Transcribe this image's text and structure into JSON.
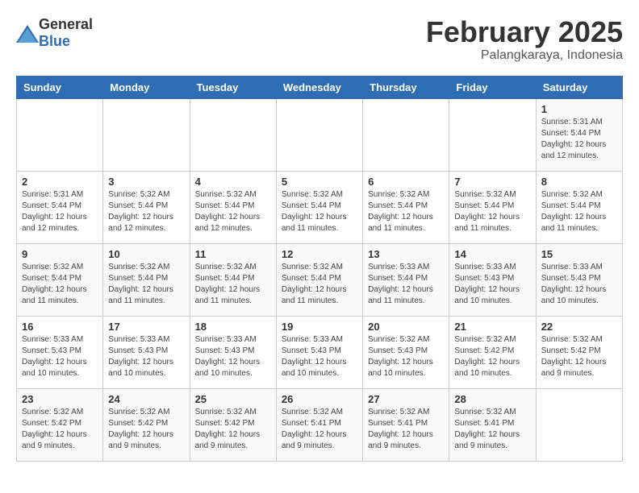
{
  "app": {
    "name_general": "General",
    "name_blue": "Blue"
  },
  "header": {
    "month": "February 2025",
    "location": "Palangkaraya, Indonesia"
  },
  "weekdays": [
    "Sunday",
    "Monday",
    "Tuesday",
    "Wednesday",
    "Thursday",
    "Friday",
    "Saturday"
  ],
  "weeks": [
    [
      {
        "day": "",
        "info": ""
      },
      {
        "day": "",
        "info": ""
      },
      {
        "day": "",
        "info": ""
      },
      {
        "day": "",
        "info": ""
      },
      {
        "day": "",
        "info": ""
      },
      {
        "day": "",
        "info": ""
      },
      {
        "day": "1",
        "info": "Sunrise: 5:31 AM\nSunset: 5:44 PM\nDaylight: 12 hours\nand 12 minutes."
      }
    ],
    [
      {
        "day": "2",
        "info": "Sunrise: 5:31 AM\nSunset: 5:44 PM\nDaylight: 12 hours\nand 12 minutes."
      },
      {
        "day": "3",
        "info": "Sunrise: 5:32 AM\nSunset: 5:44 PM\nDaylight: 12 hours\nand 12 minutes."
      },
      {
        "day": "4",
        "info": "Sunrise: 5:32 AM\nSunset: 5:44 PM\nDaylight: 12 hours\nand 12 minutes."
      },
      {
        "day": "5",
        "info": "Sunrise: 5:32 AM\nSunset: 5:44 PM\nDaylight: 12 hours\nand 11 minutes."
      },
      {
        "day": "6",
        "info": "Sunrise: 5:32 AM\nSunset: 5:44 PM\nDaylight: 12 hours\nand 11 minutes."
      },
      {
        "day": "7",
        "info": "Sunrise: 5:32 AM\nSunset: 5:44 PM\nDaylight: 12 hours\nand 11 minutes."
      },
      {
        "day": "8",
        "info": "Sunrise: 5:32 AM\nSunset: 5:44 PM\nDaylight: 12 hours\nand 11 minutes."
      }
    ],
    [
      {
        "day": "9",
        "info": "Sunrise: 5:32 AM\nSunset: 5:44 PM\nDaylight: 12 hours\nand 11 minutes."
      },
      {
        "day": "10",
        "info": "Sunrise: 5:32 AM\nSunset: 5:44 PM\nDaylight: 12 hours\nand 11 minutes."
      },
      {
        "day": "11",
        "info": "Sunrise: 5:32 AM\nSunset: 5:44 PM\nDaylight: 12 hours\nand 11 minutes."
      },
      {
        "day": "12",
        "info": "Sunrise: 5:32 AM\nSunset: 5:44 PM\nDaylight: 12 hours\nand 11 minutes."
      },
      {
        "day": "13",
        "info": "Sunrise: 5:33 AM\nSunset: 5:44 PM\nDaylight: 12 hours\nand 11 minutes."
      },
      {
        "day": "14",
        "info": "Sunrise: 5:33 AM\nSunset: 5:43 PM\nDaylight: 12 hours\nand 10 minutes."
      },
      {
        "day": "15",
        "info": "Sunrise: 5:33 AM\nSunset: 5:43 PM\nDaylight: 12 hours\nand 10 minutes."
      }
    ],
    [
      {
        "day": "16",
        "info": "Sunrise: 5:33 AM\nSunset: 5:43 PM\nDaylight: 12 hours\nand 10 minutes."
      },
      {
        "day": "17",
        "info": "Sunrise: 5:33 AM\nSunset: 5:43 PM\nDaylight: 12 hours\nand 10 minutes."
      },
      {
        "day": "18",
        "info": "Sunrise: 5:33 AM\nSunset: 5:43 PM\nDaylight: 12 hours\nand 10 minutes."
      },
      {
        "day": "19",
        "info": "Sunrise: 5:33 AM\nSunset: 5:43 PM\nDaylight: 12 hours\nand 10 minutes."
      },
      {
        "day": "20",
        "info": "Sunrise: 5:32 AM\nSunset: 5:43 PM\nDaylight: 12 hours\nand 10 minutes."
      },
      {
        "day": "21",
        "info": "Sunrise: 5:32 AM\nSunset: 5:42 PM\nDaylight: 12 hours\nand 10 minutes."
      },
      {
        "day": "22",
        "info": "Sunrise: 5:32 AM\nSunset: 5:42 PM\nDaylight: 12 hours\nand 9 minutes."
      }
    ],
    [
      {
        "day": "23",
        "info": "Sunrise: 5:32 AM\nSunset: 5:42 PM\nDaylight: 12 hours\nand 9 minutes."
      },
      {
        "day": "24",
        "info": "Sunrise: 5:32 AM\nSunset: 5:42 PM\nDaylight: 12 hours\nand 9 minutes."
      },
      {
        "day": "25",
        "info": "Sunrise: 5:32 AM\nSunset: 5:42 PM\nDaylight: 12 hours\nand 9 minutes."
      },
      {
        "day": "26",
        "info": "Sunrise: 5:32 AM\nSunset: 5:41 PM\nDaylight: 12 hours\nand 9 minutes."
      },
      {
        "day": "27",
        "info": "Sunrise: 5:32 AM\nSunset: 5:41 PM\nDaylight: 12 hours\nand 9 minutes."
      },
      {
        "day": "28",
        "info": "Sunrise: 5:32 AM\nSunset: 5:41 PM\nDaylight: 12 hours\nand 9 minutes."
      },
      {
        "day": "",
        "info": ""
      }
    ]
  ]
}
